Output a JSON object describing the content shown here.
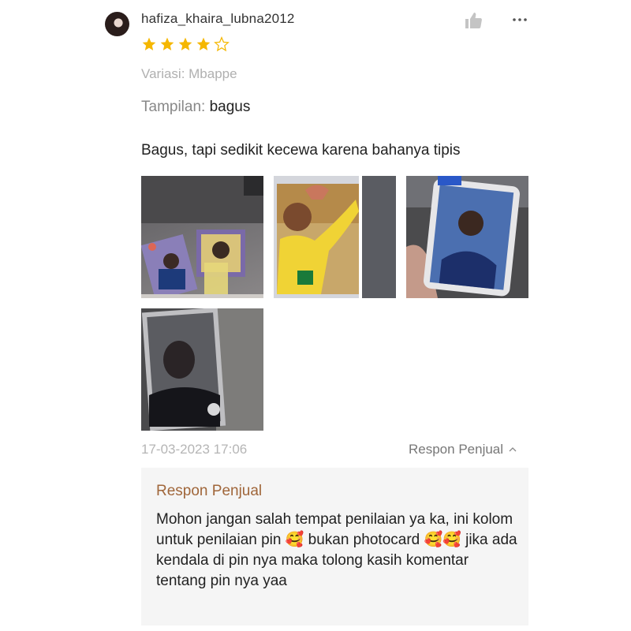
{
  "review": {
    "username": "hafiza_khaira_lubna2012",
    "rating": 4,
    "rating_max": 5,
    "variasi": "Variasi: Mbappe",
    "tampilan_label": "Tampilan:",
    "tampilan_value": "bagus",
    "comment": "Bagus, tapi sedikit kecewa karena bahanya tipis",
    "timestamp": "17-03-2023 17:06",
    "photo_count": 4
  },
  "seller_response": {
    "toggle_label": "Respon Penjual",
    "title": "Respon Penjual",
    "text": "Mohon jangan salah tempat penilaian ya ka, ini kolom untuk penilaian pin 🥰 bukan photocard 🥰🥰 jika ada kendala di pin nya maka tolong kasih komentar tentang pin nya yaa"
  },
  "colors": {
    "star": "#f5b700",
    "seller_title": "#a0663a",
    "reply_bg": "#f5f5f5",
    "muted_text": "#b0b0b0"
  },
  "icons": [
    "avatar",
    "thumbs-up-icon",
    "more-icon",
    "star-icon",
    "chevron-up-icon"
  ]
}
